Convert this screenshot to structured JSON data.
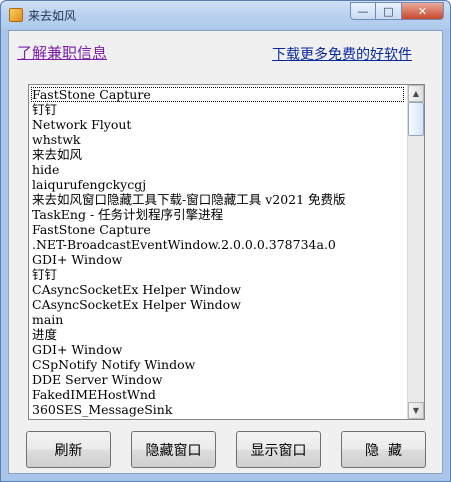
{
  "window": {
    "title": "来去如风",
    "minimize_glyph": "—",
    "maximize_glyph": "□",
    "close_glyph": "✕"
  },
  "links": {
    "left": "了解兼职信息",
    "right": "下载更多免费的好软件"
  },
  "list": {
    "selected_index": 0,
    "items": [
      "FastStone Capture",
      "钉钉",
      "Network Flyout",
      "whstwk",
      "来去如风",
      "hide",
      "laiqurufengckycgj",
      "来去如风窗口隐藏工具下载-窗口隐藏工具 v2021 免费版",
      "TaskEng - 任务计划程序引擎进程",
      "FastStone Capture",
      ".NET-BroadcastEventWindow.2.0.0.0.378734a.0",
      "GDI+ Window",
      "钉钉",
      "CAsyncSocketEx Helper Window",
      "CAsyncSocketEx Helper Window",
      "main",
      "进度",
      "GDI+ Window",
      "CSpNotify Notify Window",
      "DDE Server Window",
      "FakedIMEHostWnd",
      "360SES_MessageSink"
    ]
  },
  "scrollbar": {
    "up_glyph": "▲",
    "down_glyph": "▼"
  },
  "buttons": {
    "refresh": "刷新",
    "hide_window": "隐藏窗口",
    "show_window": "显示窗口",
    "hide": "隐  藏"
  }
}
